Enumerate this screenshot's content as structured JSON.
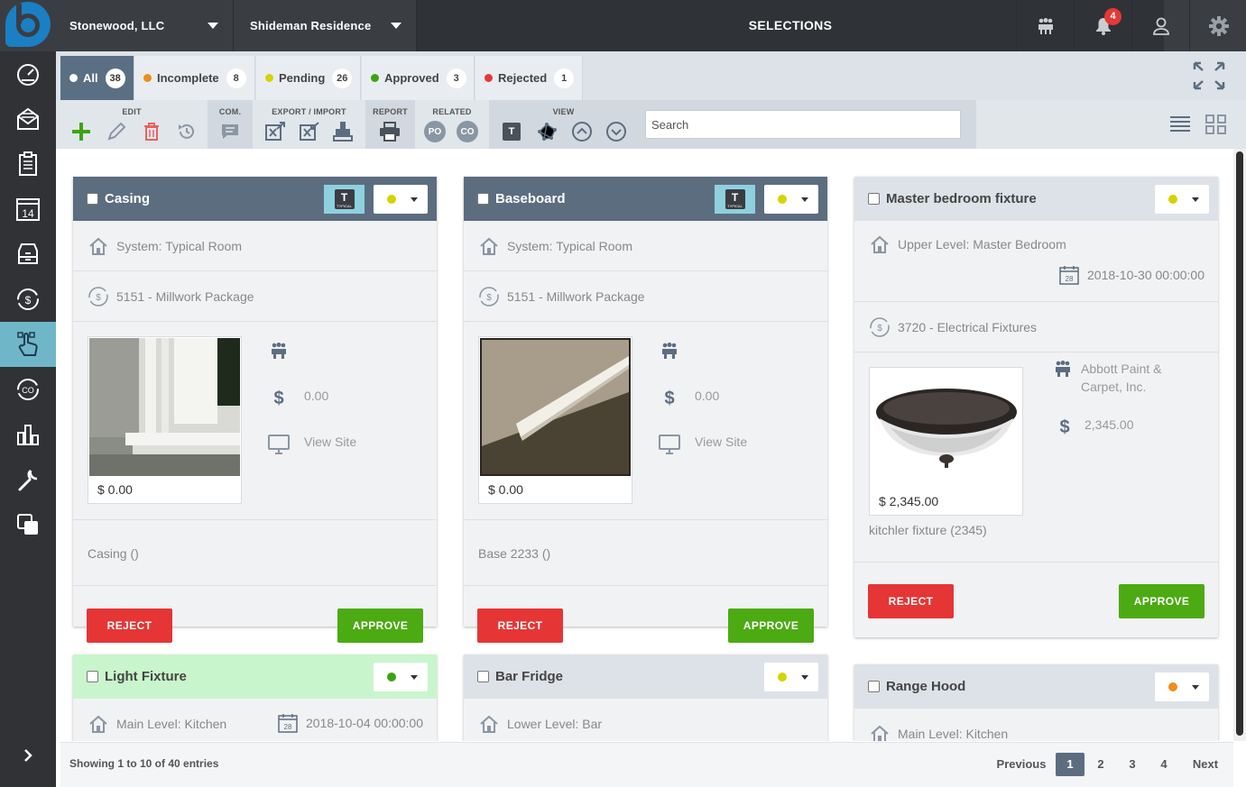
{
  "header": {
    "company": "Stonewood, LLC",
    "project": "Shideman Residence",
    "title": "SELECTIONS",
    "notification_count": "4"
  },
  "sidebar": {
    "items": [
      "dashboard",
      "mail",
      "checklist",
      "calendar",
      "filing",
      "budget",
      "selections",
      "change-orders",
      "reports",
      "tools",
      "copy"
    ],
    "calendar_day": "14"
  },
  "tabs": [
    {
      "label": "All",
      "count": "38",
      "color": "#ffffff"
    },
    {
      "label": "Incomplete",
      "count": "8",
      "color": "#f28c1a"
    },
    {
      "label": "Pending",
      "count": "26",
      "color": "#d4d400"
    },
    {
      "label": "Approved",
      "count": "3",
      "color": "#3fa30f"
    },
    {
      "label": "Rejected",
      "count": "1",
      "color": "#e53935"
    }
  ],
  "toolbar": {
    "edit": "EDIT",
    "com": "COM.",
    "export_import": "EXPORT / IMPORT",
    "report": "REPORT",
    "related": "RELATED",
    "related_po": "PO",
    "related_co": "CO",
    "view": "VIEW",
    "search_placeholder": "Search"
  },
  "cards": [
    {
      "title": "Casing",
      "location": "System: Typical Room",
      "cost_code": "5151 - Millwork Package",
      "price": "$ 0.00",
      "vendor_price": "0.00",
      "view_site": "View Site",
      "desc": "Casing ()",
      "status_color": "#d4d400"
    },
    {
      "title": "Baseboard",
      "location": "System: Typical Room",
      "cost_code": "5151 - Millwork Package",
      "price": "$ 0.00",
      "vendor_price": "0.00",
      "view_site": "View Site",
      "desc": "Base 2233 ()",
      "status_color": "#d4d400"
    },
    {
      "title": "Master bedroom fixture",
      "location": "Upper Level: Master Bedroom",
      "date": "2018-10-30 00:00:00",
      "cost_code": "3720 - Electrical Fixtures",
      "price": "$ 2,345.00",
      "vendor": "Abbott Paint & Carpet, Inc.",
      "vendor_price": "2,345.00",
      "desc": "kitchler fixture (2345)",
      "status_color": "#d4d400"
    },
    {
      "title": "Light Fixture",
      "location": "Main Level: Kitchen",
      "date": "2018-10-04 00:00:00",
      "status_color": "#3fa30f"
    },
    {
      "title": "Bar Fridge",
      "location": "Lower Level: Bar",
      "status_color": "#d4d400"
    },
    {
      "title": "Range Hood",
      "location": "Main Level: Kitchen",
      "status_color": "#f28c1a"
    }
  ],
  "buttons": {
    "reject": "REJECT",
    "approve": "APPROVE"
  },
  "typical_badge": {
    "letter": "T",
    "caption": "TYPICAL"
  },
  "pagination": {
    "info": "Showing 1 to 10 of 40 entries",
    "previous": "Previous",
    "pages": [
      "1",
      "2",
      "3",
      "4"
    ],
    "next": "Next"
  }
}
